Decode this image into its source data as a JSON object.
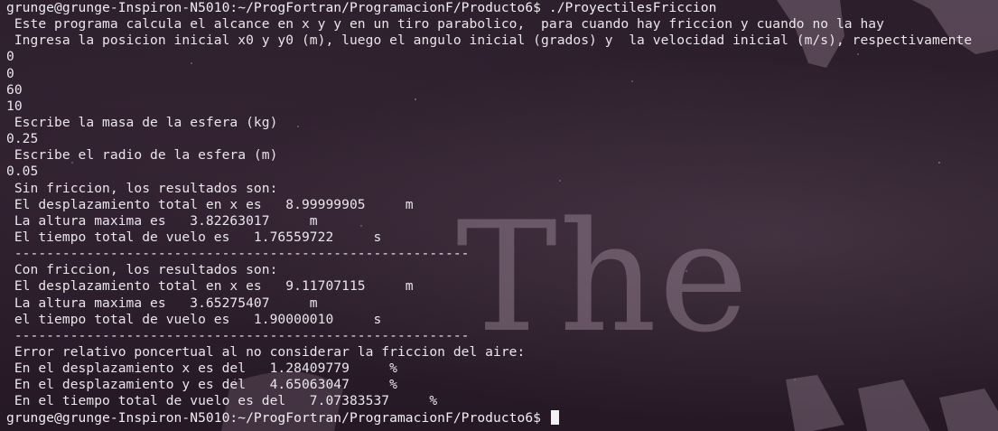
{
  "window": {
    "type": "terminal"
  },
  "wallpaper": {
    "text_the": "The"
  },
  "terminal": {
    "lines": [
      "grunge@grunge-Inspiron-N5010:~/ProgFortran/ProgramacionF/Producto6$ ./ProyectilesFriccion",
      " Este programa calcula el alcance en x y y en un tiro parabolico,  para cuando hay friccion y cuando no la hay",
      " Ingresa la posicion inicial x0 y y0 (m), luego el angulo inicial (grados) y  la velocidad inicial (m/s), respectivamente",
      "0",
      "0",
      "60",
      "10",
      " Escribe la masa de la esfera (kg)",
      "0.25",
      " Escribe el radio de la esfera (m)",
      "0.05",
      " Sin friccion, los resultados son:",
      " El desplazamiento total en x es   8.99999905     m",
      " La altura maxima es   3.82263017     m",
      " El tiempo total de vuelo es   1.76559722     s",
      " ---------------------------------------------------------",
      " Con friccion, los resultados son:",
      " El desplazamiento total en x es   9.11707115     m",
      " La altura maxima es   3.65275407     m",
      " el tiempo total de vuelo es   1.90000010     s",
      " ---------------------------------------------------------",
      " Error relativo poncertual al no considerar la friccion del aire:",
      " En el desplazamiento x es del   1.28409779     %",
      " En el desplazamiento y es del   4.65063047     %",
      " En el tiempo total de vuelo es del   7.07383537     %"
    ],
    "final_prompt": "grunge@grunge-Inspiron-N5010:~/ProgFortran/ProgramacionF/Producto6$ "
  }
}
